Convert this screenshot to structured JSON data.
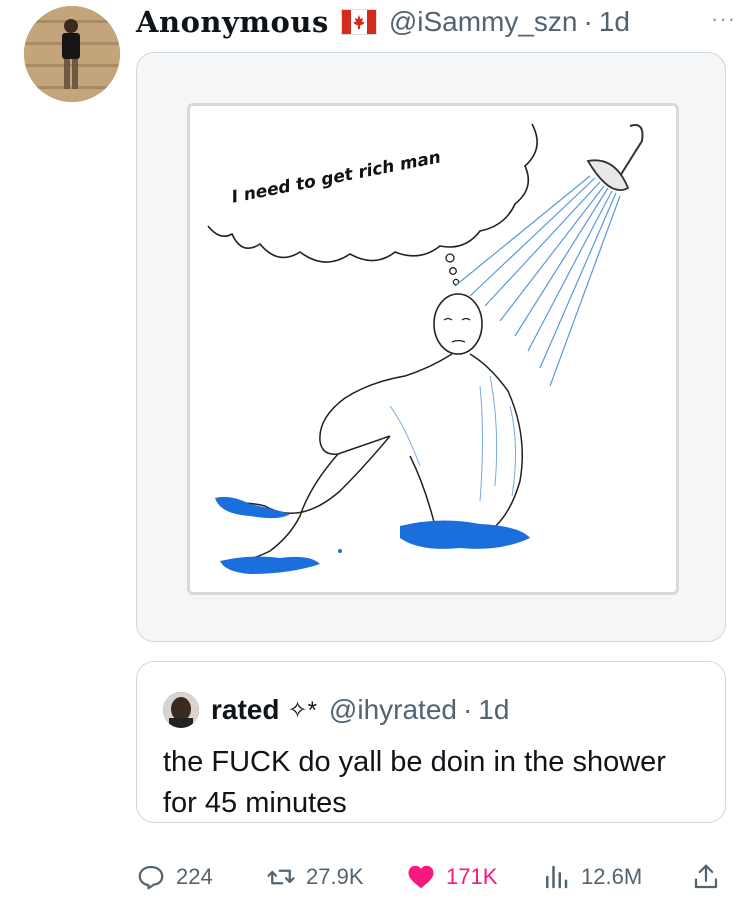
{
  "tweet": {
    "display_name": "Anonymous",
    "flag_icon": "canada-flag-icon",
    "handle": "@iSammy_szn",
    "separator": "·",
    "time": "1d",
    "more_icon": "more-icon",
    "more_label": "···",
    "media": {
      "caption": "I need to get rich man"
    }
  },
  "quote": {
    "name": "rated",
    "sparkle": "✧*",
    "handle": "@ihyrated",
    "separator": "·",
    "time": "1d",
    "text": "the FUCK do yall be doin in the shower for 45 minutes"
  },
  "actions": {
    "replies": "224",
    "retweets": "27.9K",
    "likes": "171K",
    "views": "12.6M"
  },
  "colors": {
    "like": "#f91880",
    "secondary_text": "#536471",
    "water": "#1a6fdc"
  }
}
